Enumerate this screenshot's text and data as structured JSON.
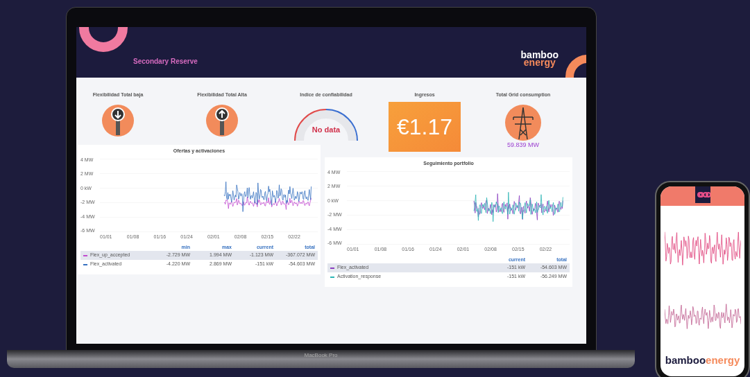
{
  "laptop": {
    "label": "MacBook Pro",
    "dashboard": {
      "title": "Secondary Reserve",
      "logo": [
        "bamboo",
        "energy"
      ],
      "stats": [
        {
          "kind": "arrow_down",
          "title": "Flexibilidad Total baja"
        },
        {
          "kind": "arrow_up",
          "title": "Flexibilidad Total Alta"
        },
        {
          "kind": "gauge",
          "title": "Indice de confiabilidad",
          "value": "No data"
        },
        {
          "kind": "value",
          "title": "Ingresos",
          "value": "€1.17"
        },
        {
          "kind": "tower",
          "title": "Total Grid consumption",
          "value": "59.839 MW"
        }
      ],
      "panels": [
        {
          "title": "Ofertas y activaciones",
          "yticks": [
            "4 MW",
            "2 MW",
            "0 kW",
            "-2 MW",
            "-4 MW",
            "-6 MW"
          ],
          "xticks": [
            "01/01",
            "01/08",
            "01/16",
            "01/24",
            "02/01",
            "02/08",
            "02/15",
            "02/22"
          ],
          "legend_columns": [
            "min",
            "max",
            "current",
            "total"
          ],
          "legend_rows": [
            {
              "name": "Flex_up_accepted",
              "color": "#c24ad0",
              "selected": true,
              "values": [
                "-2.729 MW",
                "1.994 MW",
                "-1.123 MW",
                "-367.072 MW"
              ]
            },
            {
              "name": "Flex_activated",
              "color": "#3671c0",
              "selected": false,
              "values": [
                "-4.220 MW",
                "2.869 MW",
                "-151 kW",
                "-54.603 MW"
              ]
            }
          ]
        },
        {
          "title": "Seguimiento portfolio",
          "yticks": [
            "4 MW",
            "2 MW",
            "0 kW",
            "-2 MW",
            "-4 MW",
            "-6 MW"
          ],
          "xticks": [
            "01/01",
            "01/08",
            "01/16",
            "01/24",
            "02/01",
            "02/08",
            "02/15",
            "02/22"
          ],
          "legend_columns": [
            "current",
            "total"
          ],
          "legend_rows": [
            {
              "name": "Flex_activated",
              "color": "#8a3fc0",
              "selected": true,
              "values": [
                "-151 kW",
                "-54.603 MW"
              ]
            },
            {
              "name": "Activation_response",
              "color": "#2db5b5",
              "selected": false,
              "values": [
                "-151 kW",
                "-56.249 MW"
              ]
            }
          ]
        }
      ]
    }
  },
  "phone": {
    "logo": [
      "bamboo",
      "energy"
    ]
  }
}
